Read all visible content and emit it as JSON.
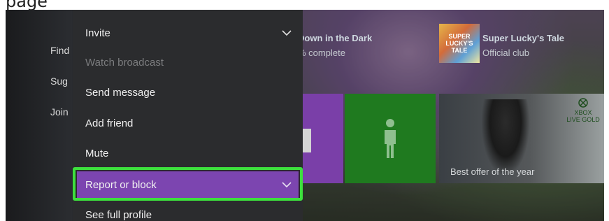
{
  "top_strip": {
    "cropped_text": "page"
  },
  "left_panel": {
    "items": [
      "Find",
      "Sug",
      "Join"
    ]
  },
  "background_tiles": {
    "game1": {
      "title": "Down in the Dark",
      "subtitle": "% complete"
    },
    "game2": {
      "title": "Super Lucky's Tale",
      "subtitle": "Official club",
      "thumb_text": "SUPER LUCKY'S TALE"
    },
    "promo": {
      "caption": "Best offer of the year",
      "badge_line1": "XBOX",
      "badge_line2": "LIVE GOLD"
    }
  },
  "context_menu": {
    "items": [
      {
        "label": "Invite",
        "has_submenu": true,
        "disabled": false,
        "selected": false
      },
      {
        "label": "Watch broadcast",
        "has_submenu": false,
        "disabled": true,
        "selected": false
      },
      {
        "label": "Send message",
        "has_submenu": false,
        "disabled": false,
        "selected": false
      },
      {
        "label": "Add friend",
        "has_submenu": false,
        "disabled": false,
        "selected": false
      },
      {
        "label": "Mute",
        "has_submenu": false,
        "disabled": false,
        "selected": false
      },
      {
        "label": "Report or block",
        "has_submenu": true,
        "disabled": false,
        "selected": true
      },
      {
        "label": "See full profile",
        "has_submenu": false,
        "disabled": false,
        "selected": false
      }
    ]
  },
  "colors": {
    "menu_background": "#2b2c2e",
    "selected_item": "#7c45b0",
    "highlight_outline": "#3de03d",
    "green_tile": "#1f7a1f",
    "purple_tile": "#7a3fa8"
  }
}
